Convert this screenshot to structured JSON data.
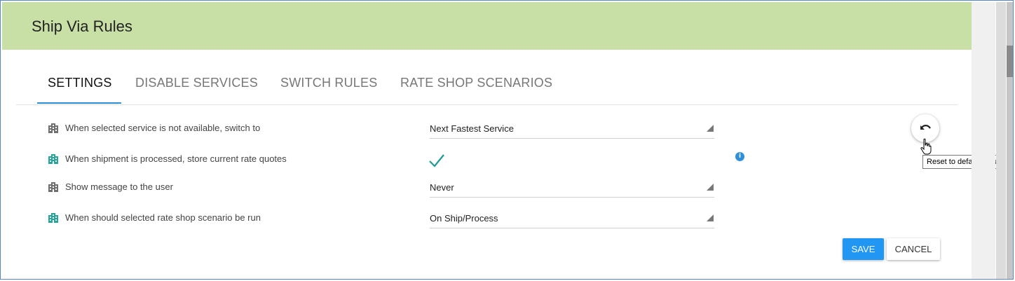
{
  "header": {
    "title": "Ship Via Rules"
  },
  "tabs": [
    {
      "label": "SETTINGS",
      "active": true
    },
    {
      "label": "DISABLE SERVICES",
      "active": false
    },
    {
      "label": "SWITCH RULES",
      "active": false
    },
    {
      "label": "RATE SHOP SCENARIOS",
      "active": false
    }
  ],
  "settings": [
    {
      "label": "When selected service is not available, switch to",
      "type": "select",
      "value": "Next Fastest Service",
      "icon": "building-icon",
      "icon_color": "#6f6f6f"
    },
    {
      "label": "When shipment is processed, store current rate quotes",
      "type": "checkbox",
      "checked": true,
      "icon": "building-icon",
      "icon_color": "#26a69a"
    },
    {
      "label": "Show message to the user",
      "type": "select",
      "value": "Never",
      "icon": "building-icon",
      "icon_color": "#6f6f6f"
    },
    {
      "label": "When should selected rate shop scenario be run",
      "type": "select",
      "value": "On Ship/Process",
      "icon": "building-icon",
      "icon_color": "#26a69a"
    }
  ],
  "info_icon": "i",
  "reset": {
    "icon": "undo-icon",
    "tooltip": "Reset to default value"
  },
  "actions": {
    "save": "SAVE",
    "cancel": "CANCEL"
  },
  "colors": {
    "header_bg": "#c8e0a6",
    "accent": "#2196f3",
    "check": "#1e9a94"
  }
}
